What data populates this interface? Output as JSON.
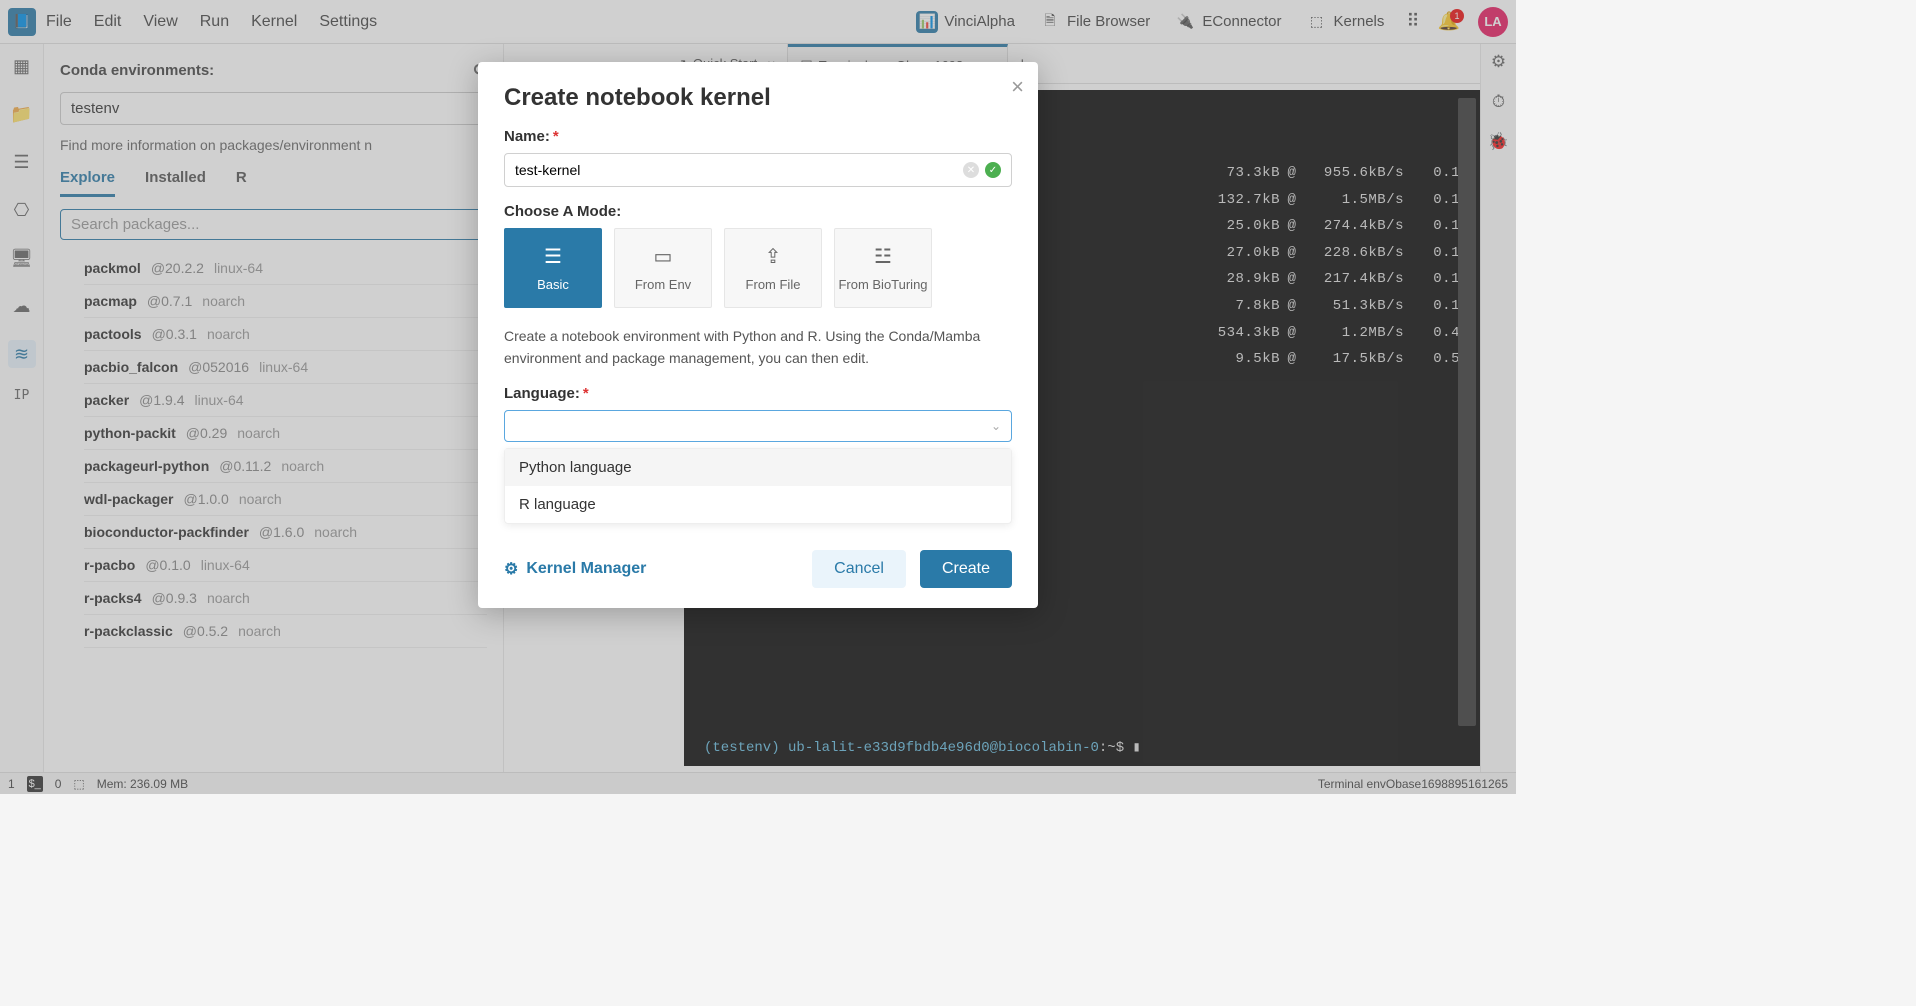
{
  "menu": {
    "items": [
      "File",
      "Edit",
      "View",
      "Run",
      "Kernel",
      "Settings"
    ]
  },
  "quick": {
    "vinci": "VinciAlpha",
    "filebrowser": "File Browser",
    "econnector": "EConnector",
    "kernels": "Kernels"
  },
  "avatar": "LA",
  "bell_count": "1",
  "rail_left": {
    "ip": "IP"
  },
  "sidebar": {
    "title": "Conda environments:",
    "env_value": "testenv",
    "hint": "Find more information on packages/environment n",
    "tabs": {
      "explore": "Explore",
      "installed": "Installed",
      "r_prefix": "R"
    },
    "search_placeholder": "Search packages...",
    "packages": [
      {
        "name": "packmol",
        "ver": "@20.2.2",
        "arch": "linux-64"
      },
      {
        "name": "pacmap",
        "ver": "@0.7.1",
        "arch": "noarch"
      },
      {
        "name": "pactools",
        "ver": "@0.3.1",
        "arch": "noarch"
      },
      {
        "name": "pacbio_falcon",
        "ver": "@052016",
        "arch": "linux-64"
      },
      {
        "name": "packer",
        "ver": "@1.9.4",
        "arch": "linux-64"
      },
      {
        "name": "python-packit",
        "ver": "@0.29",
        "arch": "noarch"
      },
      {
        "name": "packageurl-python",
        "ver": "@0.11.2",
        "arch": "noarch"
      },
      {
        "name": "wdl-packager",
        "ver": "@1.0.0",
        "arch": "noarch"
      },
      {
        "name": "bioconductor-packfinder",
        "ver": "@1.6.0",
        "arch": "noarch"
      },
      {
        "name": "r-pacbo",
        "ver": "@0.1.0",
        "arch": "linux-64"
      },
      {
        "name": "r-packs4",
        "ver": "@0.9.3",
        "arch": "noarch"
      },
      {
        "name": "r-packclassic",
        "ver": "@0.5.2",
        "arch": "noarch"
      }
    ]
  },
  "tabs": {
    "quickstart": "Quick Start",
    "terminal": "Terminal env Obase1698895",
    "add": "+"
  },
  "terminal": {
    "lines": [
      {
        "size": "73.3kB",
        "at": "@",
        "rate": "955.6kB/s",
        "t": "0.1"
      },
      {
        "size": "132.7kB",
        "at": "@",
        "rate": "1.5MB/s",
        "t": "0.1"
      },
      {
        "size": "25.0kB",
        "at": "@",
        "rate": "274.4kB/s",
        "t": "0.1"
      },
      {
        "size": "27.0kB",
        "at": "@",
        "rate": "228.6kB/s",
        "t": "0.1"
      },
      {
        "size": "28.9kB",
        "at": "@",
        "rate": "217.4kB/s",
        "t": "0.1"
      },
      {
        "size": "7.8kB",
        "at": "@",
        "rate": "51.3kB/s",
        "t": "0.1"
      },
      {
        "size": "534.3kB",
        "at": "@",
        "rate": "1.2MB/s",
        "t": "0.4"
      },
      {
        "size": "9.5kB",
        "at": "@",
        "rate": "17.5kB/s",
        "t": "0.5"
      }
    ],
    "prompt_env": "(testenv)",
    "prompt_user": "ub-lalit-e33d9fbdb4e96d0@biocolabin-0",
    "prompt_tail": ":~$"
  },
  "modal": {
    "title": "Create notebook kernel",
    "name_label": "Name:",
    "name_value": "test-kernel",
    "mode_label": "Choose A Mode:",
    "modes": {
      "basic": "Basic",
      "env": "From Env",
      "file": "From File",
      "bioturing": "From BioTuring"
    },
    "desc": "Create a notebook environment with Python and R. Using the Conda/Mamba environment and package management, you can then edit.",
    "lang_label": "Language:",
    "lang_options": {
      "py": "Python language",
      "r": "R language"
    },
    "kernel_manager": "Kernel Manager",
    "cancel": "Cancel",
    "create": "Create"
  },
  "status": {
    "left1": "1",
    "left2": "0",
    "mem": "Mem: 236.09 MB",
    "right": "Terminal envObase1698895161265"
  }
}
